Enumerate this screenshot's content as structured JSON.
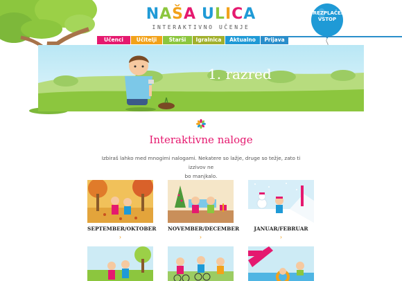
{
  "logo": {
    "title_parts": [
      {
        "text": "N",
        "color": "#1f9ad6"
      },
      {
        "text": "A",
        "color": "#8cc63e"
      },
      {
        "text": "Š",
        "color": "#f2a21a"
      },
      {
        "text": "A",
        "color": "#e5196f"
      },
      {
        "text": " ",
        "color": "#fff"
      },
      {
        "text": "U",
        "color": "#1f9ad6"
      },
      {
        "text": "L",
        "color": "#8cc63e"
      },
      {
        "text": "I",
        "color": "#f2a21a"
      },
      {
        "text": "C",
        "color": "#e5196f"
      },
      {
        "text": "A",
        "color": "#1f9ad6"
      }
    ],
    "subtitle": "INTERAKTIVNO UČENJE"
  },
  "balloon": {
    "line1": "BREZPLAČEN",
    "line2": "VSTOP",
    "color": "#1f9ad6"
  },
  "nav": [
    {
      "label": "Učenci",
      "color": "#e5196f"
    },
    {
      "label": "Učitelji",
      "color": "#f2a21a"
    },
    {
      "label": "Starši",
      "color": "#8cc63e"
    },
    {
      "label": "Igralnica",
      "color": "#a1b02c"
    },
    {
      "label": "Aktualno",
      "color": "#1f9ad6"
    },
    {
      "label": "Prijava",
      "color": "#2a8ecb"
    }
  ],
  "hero": {
    "title": "1. razred"
  },
  "section": {
    "title": "Interaktivne naloge",
    "desc_line1": "Izbiraš lahko med mnogimi nalogami. Nekatere so lažje, druge so težje, zato ti izzivov ne",
    "desc_line2": "bo manjkalo."
  },
  "cards": [
    {
      "label": "SEPTEMBER/OKTOBER",
      "arrow": "›",
      "icon": "autumn-scene"
    },
    {
      "label": "NOVEMBER/DECEMBER",
      "arrow": "›",
      "icon": "winter-holiday-scene"
    },
    {
      "label": "JANUAR/FEBRUAR",
      "arrow": "›",
      "icon": "snow-scene"
    },
    {
      "label": "",
      "arrow": "",
      "icon": "spring-park-scene"
    },
    {
      "label": "",
      "arrow": "",
      "icon": "cycling-scene"
    },
    {
      "label": "",
      "arrow": "",
      "icon": "summer-pool-scene"
    }
  ],
  "colors": {
    "pink": "#e5196f",
    "orange": "#f2a21a",
    "green": "#8cc63e",
    "blue": "#1f9ad6"
  }
}
